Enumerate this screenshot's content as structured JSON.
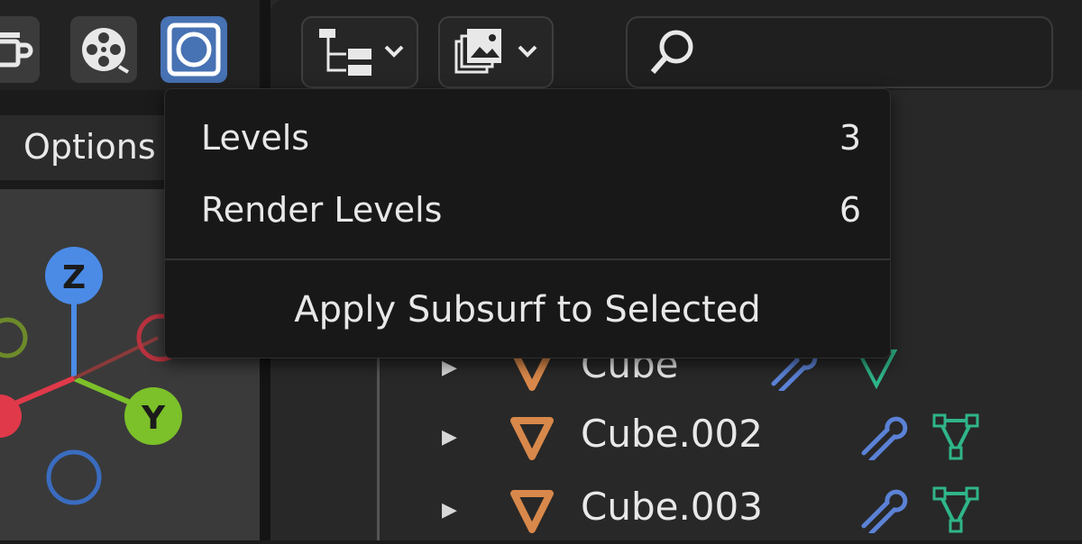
{
  "toolbar": {
    "buttons": [
      "coffee-icon",
      "film-reel-icon",
      "subsurf-icon"
    ]
  },
  "sidebar": {
    "options_label": "Options"
  },
  "gizmo": {
    "z_label": "Z",
    "y_label": "Y"
  },
  "outliner": {
    "rows": [
      {
        "name": "Cube"
      },
      {
        "name": "Cube.002"
      },
      {
        "name": "Cube.003"
      }
    ]
  },
  "popup": {
    "levels_label": "Levels",
    "levels_value": "3",
    "render_levels_label": "Render Levels",
    "render_levels_value": "6",
    "apply_label": "Apply Subsurf to Selected"
  },
  "colors": {
    "accent": "#4772b3",
    "object_orange": "#d8884a",
    "wrench_blue": "#5b82d6",
    "mesh_green": "#2fb58a"
  }
}
